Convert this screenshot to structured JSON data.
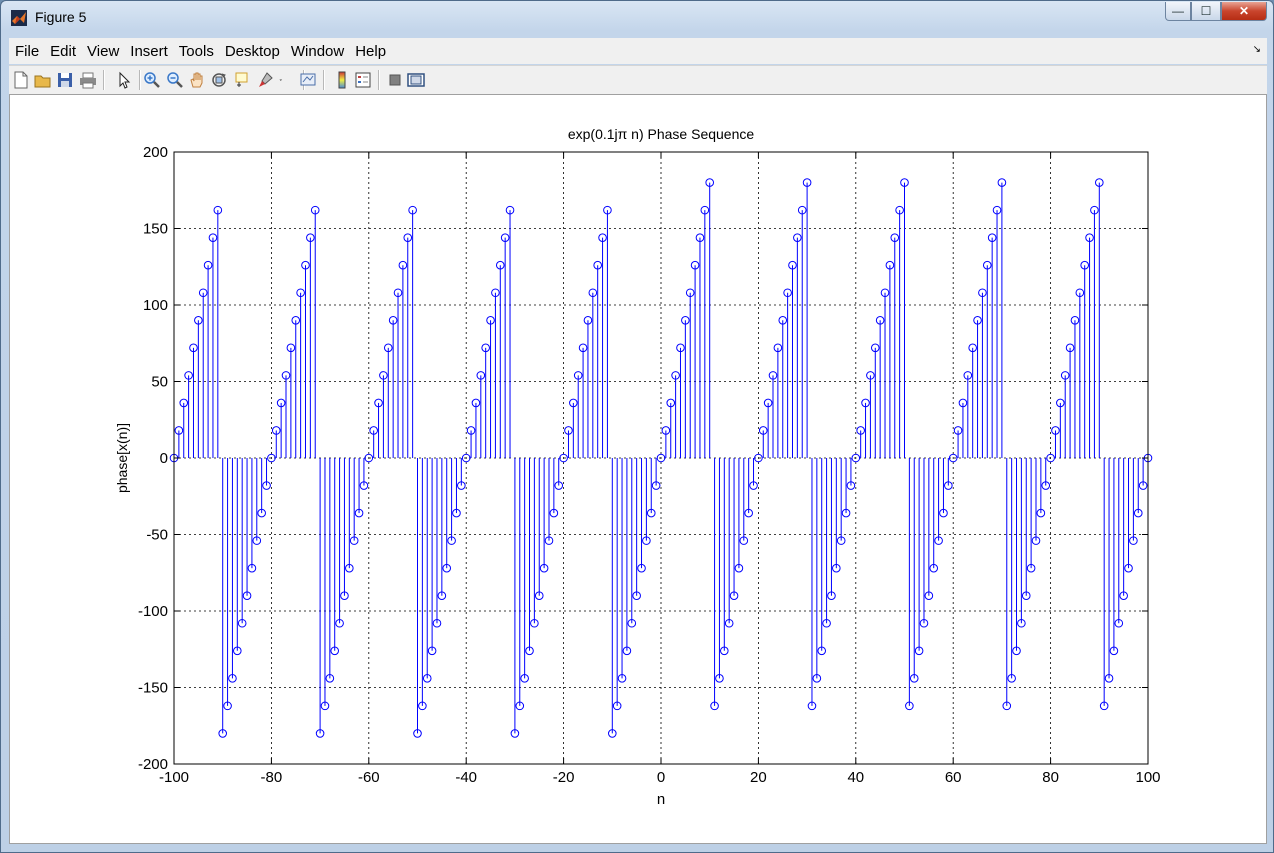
{
  "window": {
    "title": "Figure 5",
    "minimize": "—",
    "maximize": "☐",
    "close": "✕"
  },
  "menu": [
    "File",
    "Edit",
    "View",
    "Insert",
    "Tools",
    "Desktop",
    "Window",
    "Help"
  ],
  "menu_arrow": "↘",
  "toolbar": [
    {
      "name": "new-figure-icon",
      "color": "#ffffff"
    },
    {
      "name": "open-file-icon",
      "color": "#e8b84a"
    },
    {
      "name": "save-icon",
      "color": "#3b5fa8"
    },
    {
      "name": "print-icon",
      "color": "#8a8a8a"
    },
    {
      "sep": true
    },
    {
      "name": "edit-plot-arrow-icon",
      "color": "#222222"
    },
    {
      "sep": true
    },
    {
      "name": "zoom-in-icon",
      "color": "#3a78c8"
    },
    {
      "name": "zoom-out-icon",
      "color": "#3a78c8"
    },
    {
      "name": "pan-hand-icon",
      "color": "#c08040"
    },
    {
      "name": "rotate-3d-icon",
      "color": "#555555"
    },
    {
      "name": "data-cursor-icon",
      "color": "#d0a030"
    },
    {
      "name": "brush-icon",
      "color": "#cc3333"
    },
    {
      "name": "brush-dropdown-icon",
      "color": "#444444"
    },
    {
      "sep": true
    },
    {
      "name": "link-plot-icon",
      "color": "#4a6ea8"
    },
    {
      "sep": true
    },
    {
      "name": "colorbar-icon",
      "color": "#4a8ad8"
    },
    {
      "name": "legend-icon",
      "color": "#c04040"
    },
    {
      "sep": true
    },
    {
      "name": "hide-plot-tools-icon",
      "color": "#808080"
    },
    {
      "name": "show-plot-tools-icon",
      "color": "#305080"
    }
  ],
  "chart_data": {
    "type": "stem",
    "title": "exp(0.1jπ n) Phase Sequence",
    "xlabel": "n",
    "ylabel": "phase[x(n)]",
    "xlim": [
      -100,
      100
    ],
    "ylim": [
      -200,
      200
    ],
    "xticks": [
      "-100",
      "-80",
      "-60",
      "-40",
      "-20",
      "0",
      "20",
      "40",
      "60",
      "80",
      "100"
    ],
    "yticks": [
      "200",
      "150",
      "100",
      "50",
      "0",
      "-50",
      "-100",
      "-150",
      "-200"
    ],
    "grid": true,
    "color": "#0000ff",
    "marker": "circle",
    "x_start": -100,
    "x_step": 1,
    "y": [
      0,
      18,
      36,
      54,
      72,
      90,
      108,
      126,
      144,
      162,
      -180,
      -162,
      -144,
      -126,
      -108,
      -90,
      -72,
      -54,
      -36,
      -18,
      0,
      18,
      36,
      54,
      72,
      90,
      108,
      126,
      144,
      162,
      -180,
      -162,
      -144,
      -126,
      -108,
      -90,
      -72,
      -54,
      -36,
      -18,
      0,
      18,
      36,
      54,
      72,
      90,
      108,
      126,
      144,
      162,
      -180,
      -162,
      -144,
      -126,
      -108,
      -90,
      -72,
      -54,
      -36,
      -18,
      0,
      18,
      36,
      54,
      72,
      90,
      108,
      126,
      144,
      162,
      -180,
      -162,
      -144,
      -126,
      -108,
      -90,
      -72,
      -54,
      -36,
      -18,
      0,
      18,
      36,
      54,
      72,
      90,
      108,
      126,
      144,
      162,
      -180,
      -162,
      -144,
      -126,
      -108,
      -90,
      -72,
      -54,
      -36,
      -18,
      0,
      18,
      36,
      54,
      72,
      90,
      108,
      126,
      144,
      162,
      180,
      -162,
      -144,
      -126,
      -108,
      -90,
      -72,
      -54,
      -36,
      -18,
      0,
      18,
      36,
      54,
      72,
      90,
      108,
      126,
      144,
      162,
      180,
      -162,
      -144,
      -126,
      -108,
      -90,
      -72,
      -54,
      -36,
      -18,
      0,
      18,
      36,
      54,
      72,
      90,
      108,
      126,
      144,
      162,
      180,
      -162,
      -144,
      -126,
      -108,
      -90,
      -72,
      -54,
      -36,
      -18,
      0,
      18,
      36,
      54,
      72,
      90,
      108,
      126,
      144,
      162,
      180,
      -162,
      -144,
      -126,
      -108,
      -90,
      -72,
      -54,
      -36,
      -18,
      0,
      18,
      36,
      54,
      72,
      90,
      108,
      126,
      144,
      162,
      180,
      -162,
      -144,
      -126,
      -108,
      -90,
      -72,
      -54,
      -36,
      -18,
      0
    ]
  }
}
